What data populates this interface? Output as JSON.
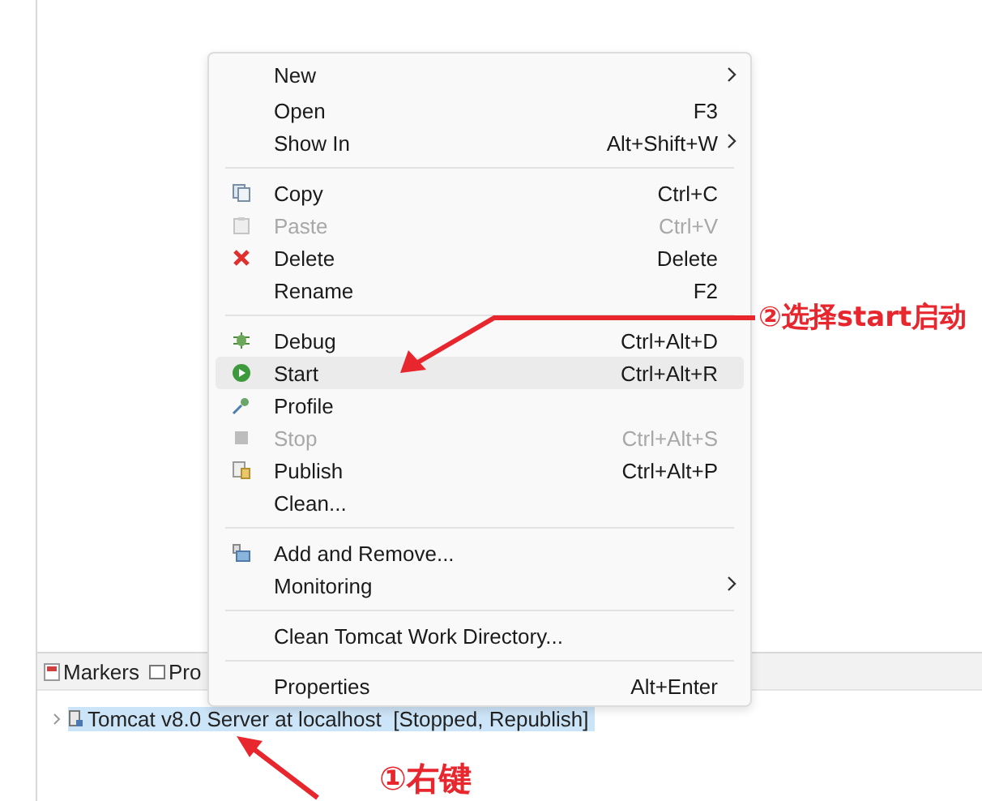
{
  "context_menu": {
    "items": [
      {
        "kind": "item",
        "label": "New",
        "submenu": true,
        "disabled": false,
        "selected": false
      },
      {
        "kind": "item",
        "label": "Open",
        "shortcut": "F3",
        "submenu": false,
        "disabled": false,
        "selected": false
      },
      {
        "kind": "item",
        "label": "Show In",
        "shortcut": "Alt+Shift+W",
        "submenu": true,
        "disabled": false,
        "selected": false
      },
      {
        "kind": "separator"
      },
      {
        "kind": "item",
        "label": "Copy",
        "shortcut": "Ctrl+C",
        "submenu": false,
        "disabled": false,
        "selected": false
      },
      {
        "kind": "item",
        "label": "Paste",
        "shortcut": "Ctrl+V",
        "submenu": false,
        "disabled": true,
        "selected": false
      },
      {
        "kind": "item",
        "label": "Delete",
        "shortcut": "Delete",
        "submenu": false,
        "disabled": false,
        "selected": false
      },
      {
        "kind": "item",
        "label": "Rename",
        "shortcut": "F2",
        "submenu": false,
        "disabled": false,
        "selected": false
      },
      {
        "kind": "separator"
      },
      {
        "kind": "item",
        "label": "Debug",
        "shortcut": "Ctrl+Alt+D",
        "submenu": false,
        "disabled": false,
        "selected": false
      },
      {
        "kind": "item",
        "label": "Start",
        "shortcut": "Ctrl+Alt+R",
        "submenu": false,
        "disabled": false,
        "selected": true
      },
      {
        "kind": "item",
        "label": "Profile",
        "submenu": false,
        "disabled": false,
        "selected": false
      },
      {
        "kind": "item",
        "label": "Stop",
        "shortcut": "Ctrl+Alt+S",
        "submenu": false,
        "disabled": true,
        "selected": false
      },
      {
        "kind": "item",
        "label": "Publish",
        "shortcut": "Ctrl+Alt+P",
        "submenu": false,
        "disabled": false,
        "selected": false
      },
      {
        "kind": "item",
        "label": "Clean...",
        "submenu": false,
        "disabled": false,
        "selected": false
      },
      {
        "kind": "separator"
      },
      {
        "kind": "item",
        "label": "Add and Remove...",
        "submenu": false,
        "disabled": false,
        "selected": false
      },
      {
        "kind": "item",
        "label": "Monitoring",
        "submenu": true,
        "disabled": false,
        "selected": false
      },
      {
        "kind": "separator"
      },
      {
        "kind": "item",
        "label": "Clean Tomcat Work Directory...",
        "submenu": false,
        "disabled": false,
        "selected": false
      },
      {
        "kind": "separator"
      },
      {
        "kind": "item",
        "label": "Properties",
        "shortcut": "Alt+Enter",
        "submenu": false,
        "disabled": false,
        "selected": false
      }
    ]
  },
  "bottom_view": {
    "tabs": [
      {
        "label": "Markers"
      },
      {
        "label": "Pro"
      }
    ],
    "tree": [
      {
        "label": "Tomcat v8.0 Server at localhost  [Stopped, Republish]",
        "expanded": false,
        "selected": true
      }
    ]
  },
  "annotations": [
    {
      "text": "②选择start启动"
    },
    {
      "text": "①右键"
    }
  ]
}
